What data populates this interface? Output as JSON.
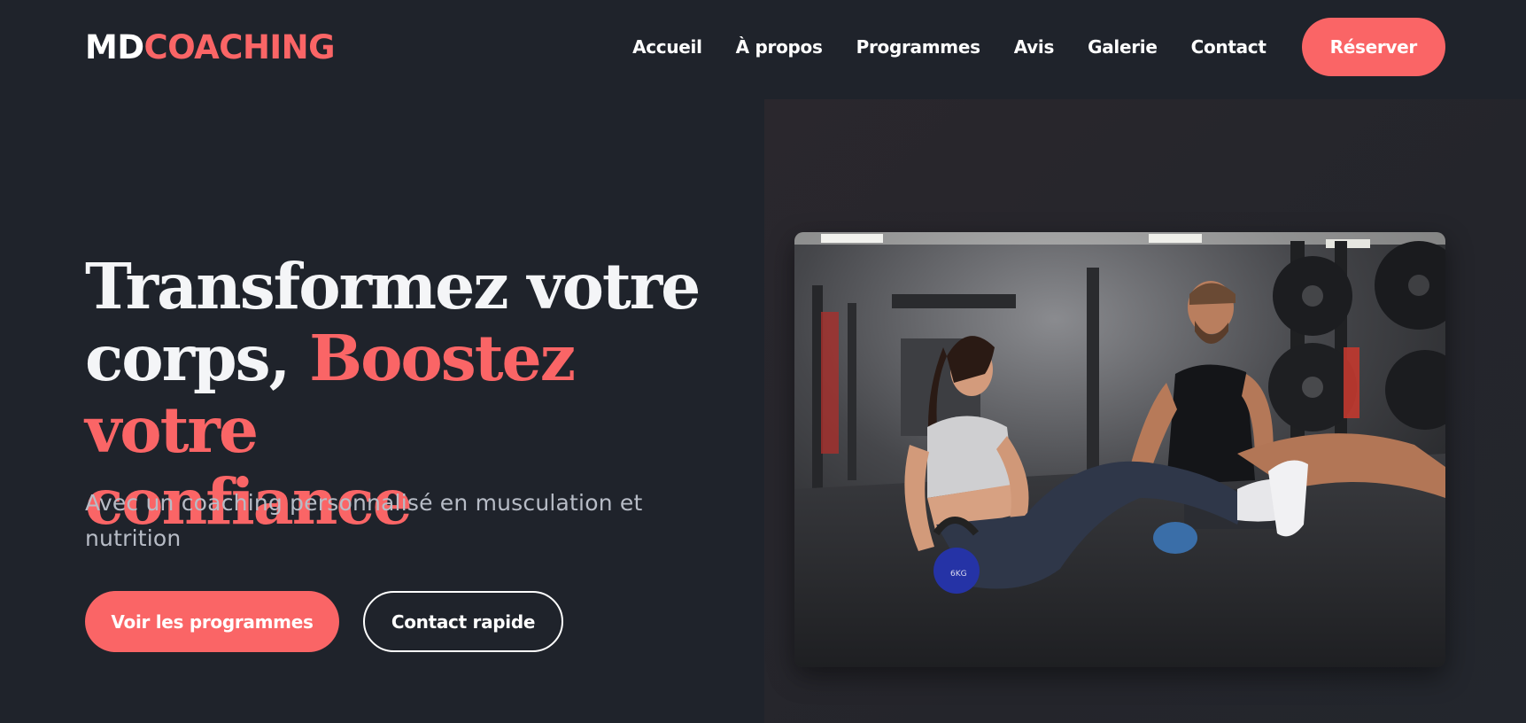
{
  "header": {
    "logo": {
      "part1": "MD",
      "part2": "COACHING"
    },
    "nav": [
      {
        "label": "Accueil"
      },
      {
        "label": "À propos"
      },
      {
        "label": "Programmes"
      },
      {
        "label": "Avis"
      },
      {
        "label": "Galerie"
      },
      {
        "label": "Contact"
      }
    ],
    "cta_label": "Réserver"
  },
  "hero": {
    "title_line1": "Transformez votre",
    "title_line2_plain": "corps, ",
    "title_line2_accent": "Boostez votre",
    "title_line3_accent": "confiance",
    "subtitle": "Avec un coaching personnalisé en musculation et nutrition",
    "primary_button": "Voir les programmes",
    "secondary_button": "Contact rapide",
    "image": {
      "kettlebell_label": "6KG"
    }
  },
  "colors": {
    "background": "#1f232b",
    "accent": "#fa6566",
    "text": "#ffffff",
    "muted_text": "#b7bcc6"
  }
}
